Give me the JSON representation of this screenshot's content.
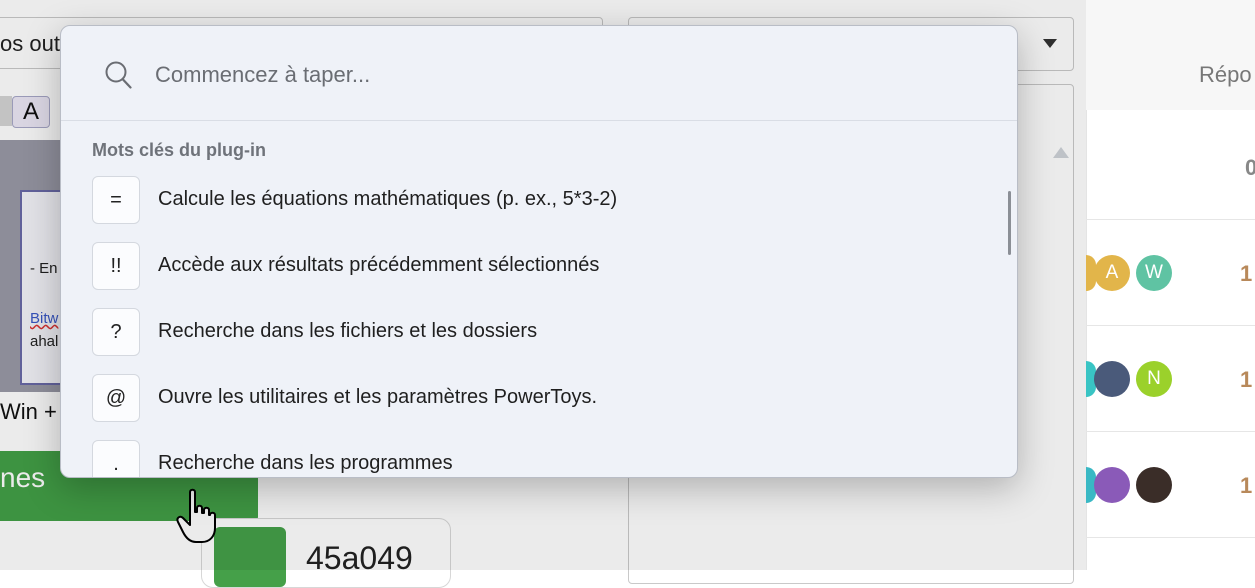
{
  "background": {
    "left_select_text": "os outi",
    "font_button_label": "A",
    "image_text_1": "- En",
    "image_text_2": "Bitw",
    "image_text_3": "ahal",
    "caption_text": "Win +",
    "green_button_label": "nes",
    "color_chip_value": "45a049",
    "color_chip_swatch": "#45a049",
    "right_panel": {
      "header": "Répo",
      "top_value": "0",
      "rows": [
        {
          "avatars": [
            "A",
            "W"
          ],
          "count": "1"
        },
        {
          "avatars": [
            "",
            "N"
          ],
          "count": "1"
        },
        {
          "avatars": [
            "",
            ""
          ],
          "count": "1"
        }
      ]
    }
  },
  "palette": {
    "search_placeholder": "Commencez à taper...",
    "section_title": "Mots clés du plug-in",
    "items": [
      {
        "keyword": "=",
        "label": "Calcule les équations mathématiques (p. ex., 5*3-2)"
      },
      {
        "keyword": "!!",
        "label": "Accède aux résultats précédemment sélectionnés"
      },
      {
        "keyword": "?",
        "label": "Recherche dans les fichiers et les dossiers"
      },
      {
        "keyword": "@",
        "label": "Ouvre les utilitaires et les paramètres PowerToys."
      },
      {
        "keyword": ".",
        "label": "Recherche dans les programmes"
      }
    ]
  },
  "colors": {
    "accent_green": "#43a047",
    "palette_bg": "#eff2f8"
  }
}
